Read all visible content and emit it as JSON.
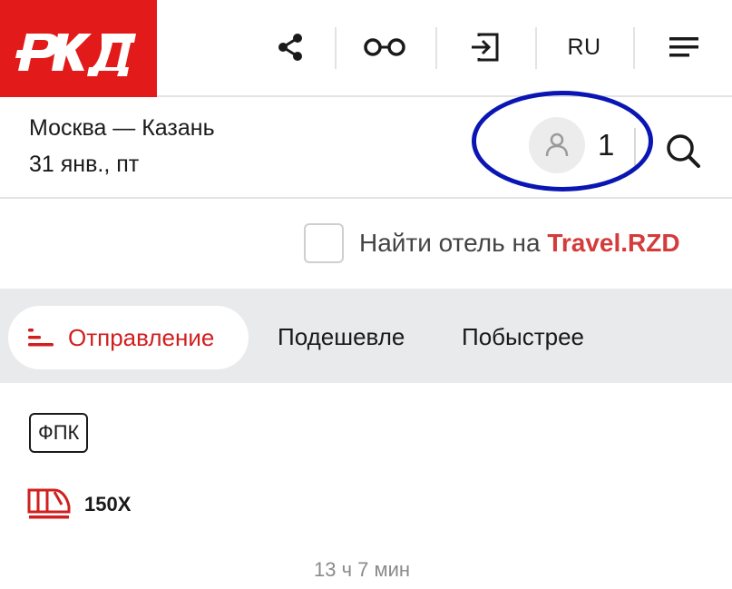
{
  "header": {
    "logo_text": "РЖД",
    "language": "RU",
    "colors": {
      "brand": "#e21a1a"
    },
    "icons": [
      "share-icon",
      "glasses-icon",
      "login-icon",
      "menu-icon"
    ]
  },
  "route": {
    "title": "Москва — Казань",
    "date": "31 янв., пт",
    "passengers": "1",
    "highlight_color": "#0a16b4"
  },
  "hotel": {
    "prefix": "Найти отель на ",
    "brand": "Travel.RZD",
    "checked": false
  },
  "sort_tabs": [
    {
      "label": "Отправление",
      "active": true
    },
    {
      "label": "Подешевле",
      "active": false
    },
    {
      "label": "Побыстрее",
      "active": false
    }
  ],
  "train": {
    "carrier": "ФПК",
    "number": "150Х",
    "duration": "13 ч 7 мин"
  }
}
